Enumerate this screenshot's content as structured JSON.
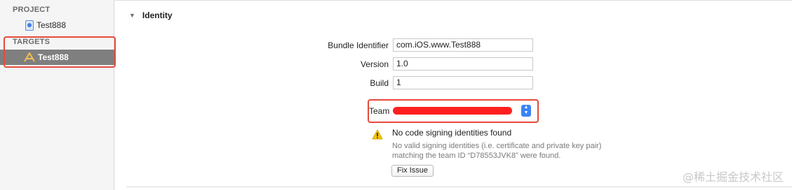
{
  "sidebar": {
    "project_header": "PROJECT",
    "project_item": {
      "label": "Test888",
      "icon": "project-file-icon"
    },
    "targets_header": "TARGETS",
    "target_item": {
      "label": "Test888",
      "icon": "app-target-icon",
      "selected": true
    }
  },
  "identity": {
    "section_title": "Identity",
    "bundle_identifier_label": "Bundle Identifier",
    "bundle_identifier_value": "com.iOS.www.Test888",
    "version_label": "Version",
    "version_value": "1.0",
    "build_label": "Build",
    "build_value": "1",
    "team_label": "Team"
  },
  "warning": {
    "title": "No code signing identities found",
    "detail_line1": "No valid signing identities (i.e. certificate and private key pair)",
    "detail_line2": "matching the team ID “D78553JVK8” were found.",
    "button_label": "Fix Issue"
  },
  "watermark": "@稀土掘金技术社区",
  "colors": {
    "annotation_red": "#e64a3a",
    "selection_gray": "#7f7f7f",
    "popup_blue": "#3a84f4",
    "warning_yellow": "#f5c400"
  }
}
